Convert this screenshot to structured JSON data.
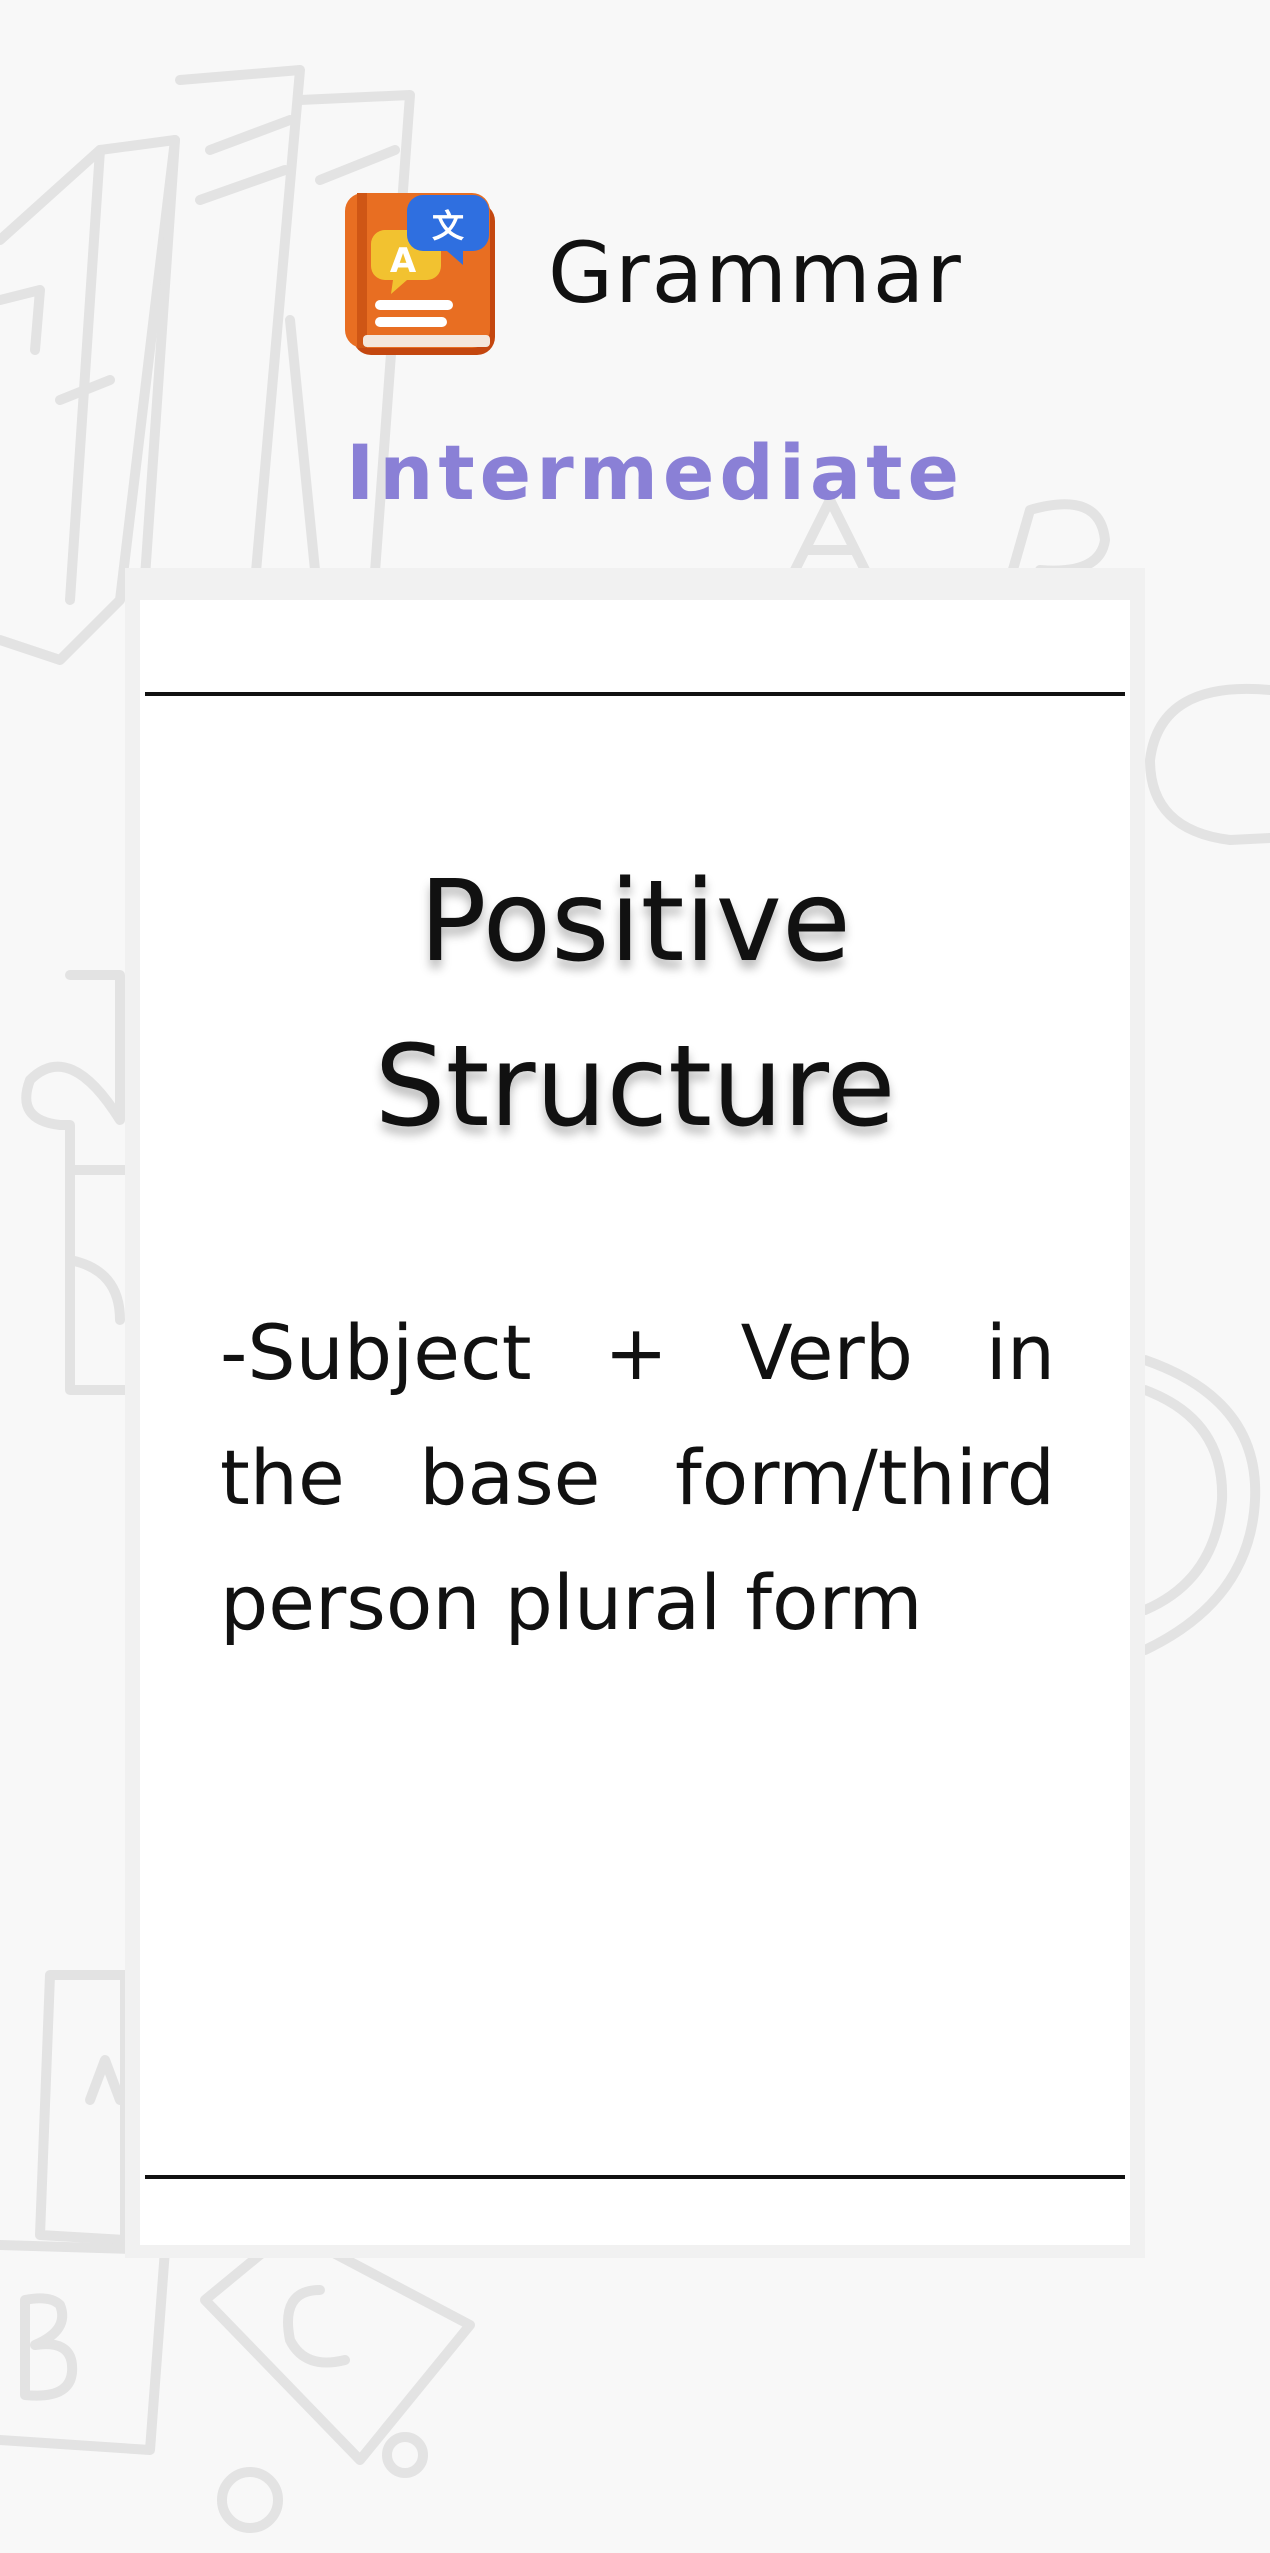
{
  "header": {
    "app_title": "Grammar",
    "level": "Intermediate"
  },
  "card": {
    "heading_line1": "Positive",
    "heading_line2": "Structure",
    "body": " -Subject + Verb in the base form/third person plural form"
  },
  "colors": {
    "background": "#f8f8f8",
    "card": "#ffffff",
    "level_text": "#8a80d6",
    "book_icon": "#e56b1f",
    "bubble_blue": "#2f6fe0",
    "bubble_yellow": "#f2c230"
  },
  "icons": {
    "app_icon": "grammar-book-icon",
    "background": "school-doodles"
  }
}
